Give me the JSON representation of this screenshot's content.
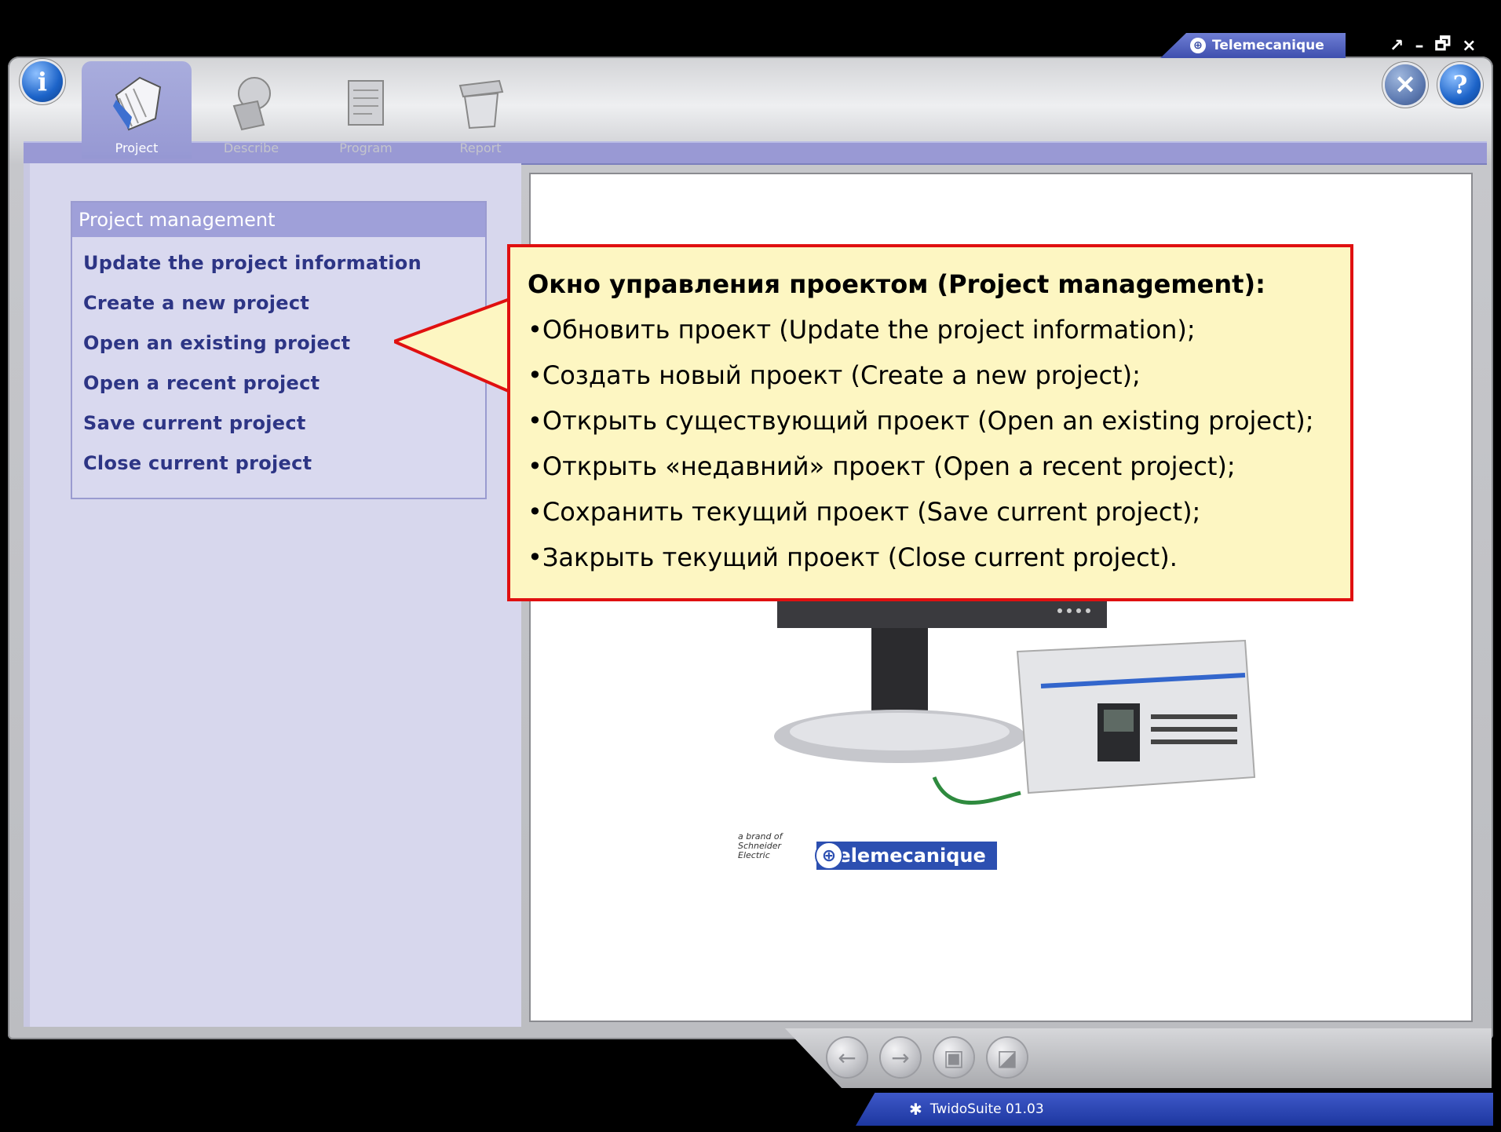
{
  "window": {
    "brand": "Telemecanique",
    "controls": [
      "↗",
      "–",
      "🗗",
      "×"
    ]
  },
  "tabs": [
    {
      "label": "Project",
      "active": true
    },
    {
      "label": "Describe",
      "active": false
    },
    {
      "label": "Program",
      "active": false
    },
    {
      "label": "Report",
      "active": false
    }
  ],
  "project_management": {
    "title": "Project management",
    "links": [
      "Update the project information",
      "Create a new project",
      "Open an existing project",
      "Open a recent project",
      "Save current project",
      "Close current project"
    ]
  },
  "callout": {
    "title": "Окно управления проектом (Project management):",
    "items": [
      "•Обновить проект (Update the project information);",
      "•Создать новый проект (Create a new project);",
      "•Открыть существующий проект (Open an existing project);",
      "•Открыть «недавний» проект (Open a recent project);",
      "•Сохранить текущий проект (Save current project);",
      "•Закрыть текущий проект (Close current project)."
    ]
  },
  "illustration": {
    "logo": "Telemecanique",
    "schneider": "a brand of Schneider Electric"
  },
  "status": {
    "app_version": "TwidoSuite 01.03"
  },
  "colors": {
    "accent": "#9999d4",
    "link": "#2d3585",
    "callout_border": "#e01010",
    "callout_bg": "#fdf6c2"
  }
}
